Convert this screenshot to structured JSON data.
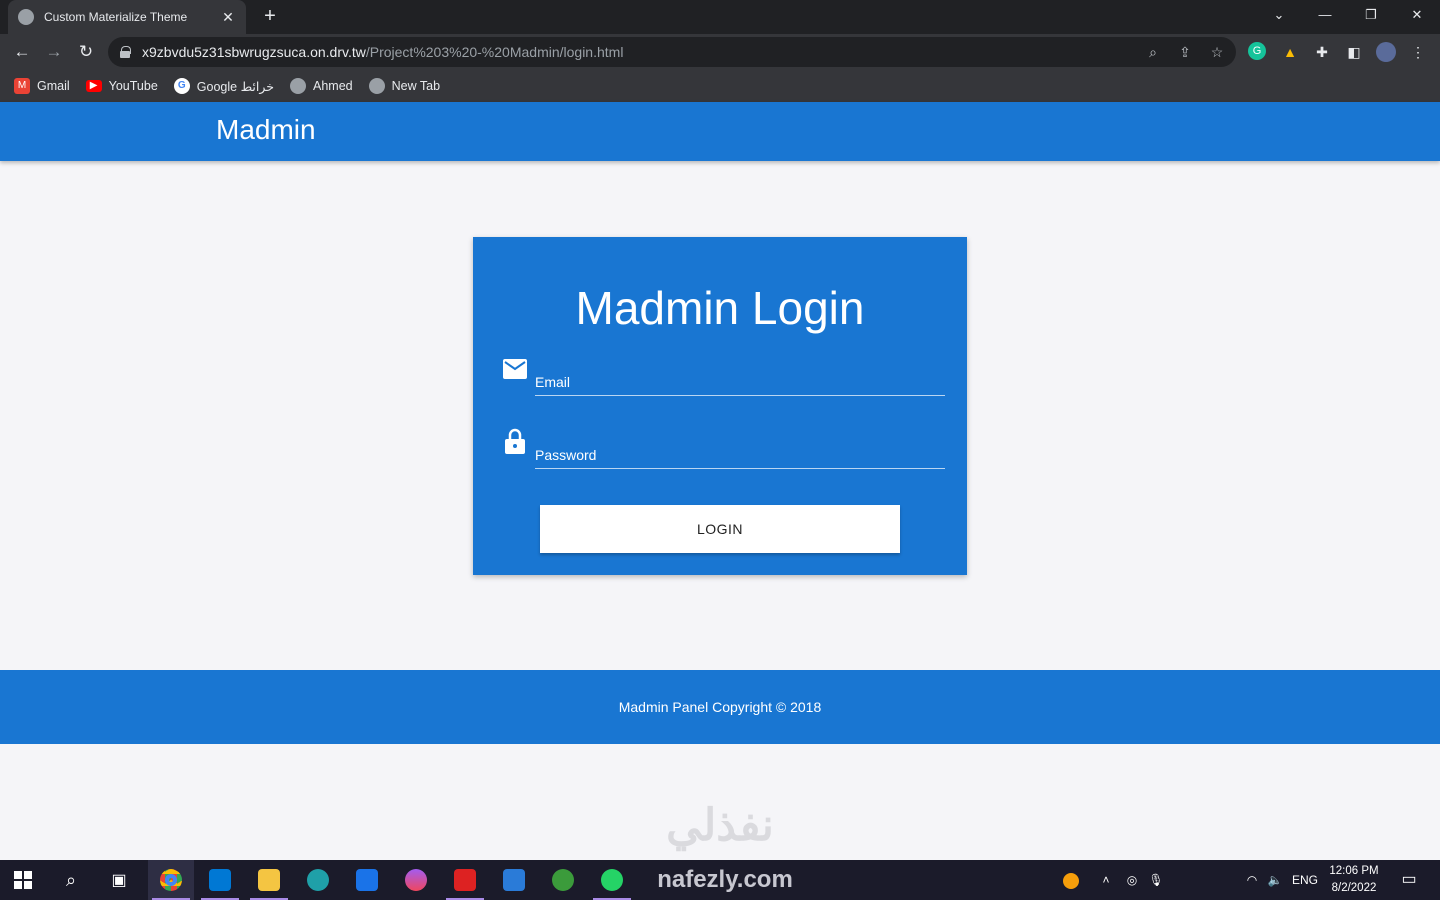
{
  "browser": {
    "tab_title": "Custom Materialize Theme",
    "tab_close": "✕",
    "new_tab": "+",
    "url_host": "x9zbvdu5z31sbwrugzsuca.on.drv.tw",
    "url_path": "/Project%203%20-%20Madmin/login.html",
    "bookmarks": [
      {
        "label": "Gmail",
        "icon": "gmail-icon",
        "color": "#ea4335"
      },
      {
        "label": "YouTube",
        "icon": "youtube-icon",
        "color": "#ff0000"
      },
      {
        "label": "Google خرائط",
        "icon": "google-icon",
        "color": "#ffffff"
      },
      {
        "label": "Ahmed",
        "icon": "globe-icon",
        "color": "#9aa0a6"
      },
      {
        "label": "New Tab",
        "icon": "globe-icon",
        "color": "#9aa0a6"
      }
    ]
  },
  "page": {
    "brand": "Madmin",
    "login_title": "Madmin Login",
    "email_placeholder": "Email",
    "password_placeholder": "Password",
    "login_button": "LOGIN",
    "footer": "Madmin Panel Copyright © 2018",
    "primary_color": "#1976d2"
  },
  "watermark": {
    "arabic": "نفذلي",
    "latin": "nafezly.com"
  },
  "taskbar": {
    "language": "ENG",
    "time": "12:06 PM",
    "date": "8/2/2022"
  }
}
